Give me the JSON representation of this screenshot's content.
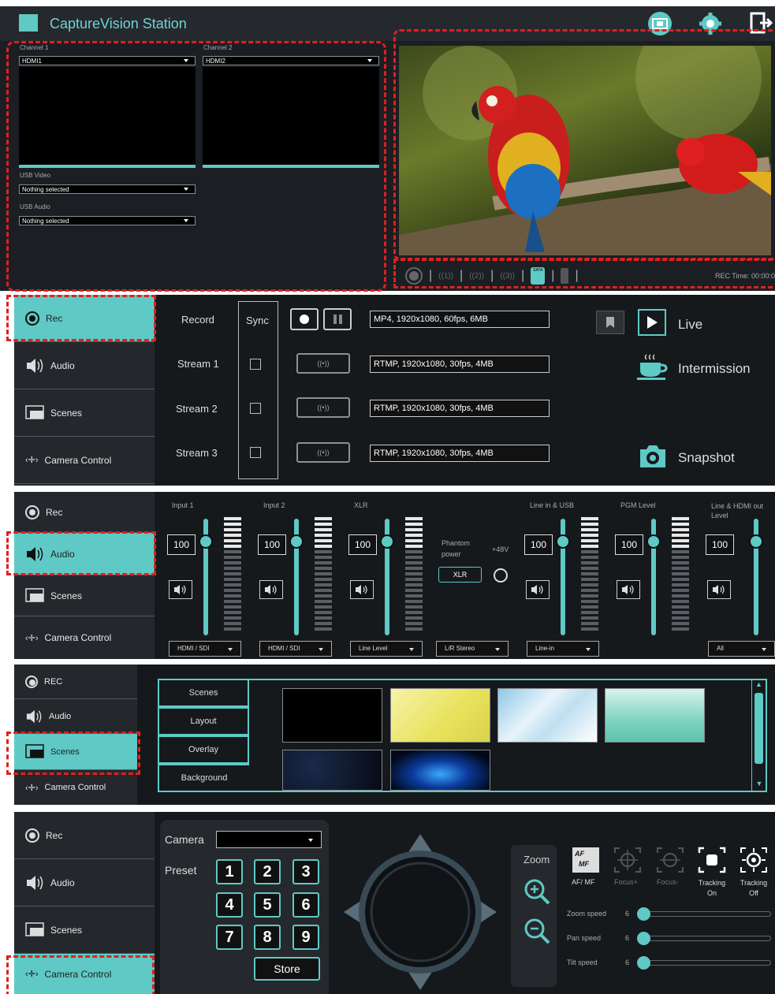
{
  "app": {
    "title": "CaptureVision Station"
  },
  "inputs": {
    "channel1": {
      "label": "Channel 1",
      "value": "HDMI1"
    },
    "channel2": {
      "label": "Channel 2",
      "value": "HDMI2"
    },
    "usb_video": {
      "label": "USB Video",
      "value": "Nothing selected"
    },
    "usb_audio": {
      "label": "USB Audio",
      "value": "Nothing selected"
    }
  },
  "status": {
    "rec_time": "REC Time: 00:00:0",
    "sata": "SATA"
  },
  "sidebar": {
    "rec": "Rec",
    "rec_caps": "REC",
    "audio": "Audio",
    "scenes": "Scenes",
    "camera_control": "Camera Control"
  },
  "rec_panel": {
    "sync": "Sync",
    "rows": [
      {
        "label": "Record",
        "format": "MP4, 1920x1080, 60fps, 6MB"
      },
      {
        "label": "Stream 1",
        "format": "RTMP, 1920x1080, 30fps, 4MB"
      },
      {
        "label": "Stream 2",
        "format": "RTMP, 1920x1080, 30fps, 4MB"
      },
      {
        "label": "Stream 3",
        "format": "RTMP, 1920x1080, 30fps, 4MB"
      }
    ],
    "stream_icons": [
      "((•))",
      "((•))",
      "((•))"
    ],
    "live": "Live",
    "intermission": "Intermission",
    "snapshot": "Snapshot"
  },
  "audio_panel": {
    "channels": [
      {
        "label": "Input 1",
        "value": "100",
        "source": "HDMI / SDI",
        "level": 0.95
      },
      {
        "label": "Input 2",
        "value": "100",
        "source": "HDMI / SDI",
        "level": 0.95
      },
      {
        "label": "XLR",
        "value": "100",
        "source": "Line Level",
        "level": 0.95
      },
      {
        "label": "Line in & USB",
        "value": "100",
        "source": "Line-in",
        "level": 0.95
      },
      {
        "label": "PGM Level",
        "value": "100",
        "source": "",
        "level": 0.95
      },
      {
        "label": "Line & HDMI out Level",
        "value": "100",
        "source": "All",
        "level": 0.95
      }
    ],
    "phantom_power": "Phantom power",
    "plus48v": "+48V",
    "xlr_button": "XLR",
    "stereo_select": "L/R Stereo"
  },
  "scenes_panel": {
    "tabs": [
      "Scenes",
      "Layout",
      "Overlay",
      "Background"
    ]
  },
  "camera_panel": {
    "camera_label": "Camera",
    "preset_label": "Preset",
    "keys": [
      "1",
      "2",
      "3",
      "4",
      "5",
      "6",
      "7",
      "8",
      "9"
    ],
    "store": "Store",
    "zoom": "Zoom",
    "af_mf": "AF/ MF",
    "focus_plus": "Focus+",
    "focus_minus": "Focus-",
    "tracking_on_1": "Tracking",
    "tracking_on_2": "On",
    "tracking_off_1": "Tracking",
    "tracking_off_2": "Off",
    "speeds": [
      {
        "label": "Zoom speed",
        "value": "6"
      },
      {
        "label": "Pan speed",
        "value": "6"
      },
      {
        "label": "Tilt speed",
        "value": "6"
      }
    ]
  },
  "colors": {
    "accent": "#5fc9c5",
    "highlight": "#e02020",
    "panel": "#1b1f23"
  }
}
